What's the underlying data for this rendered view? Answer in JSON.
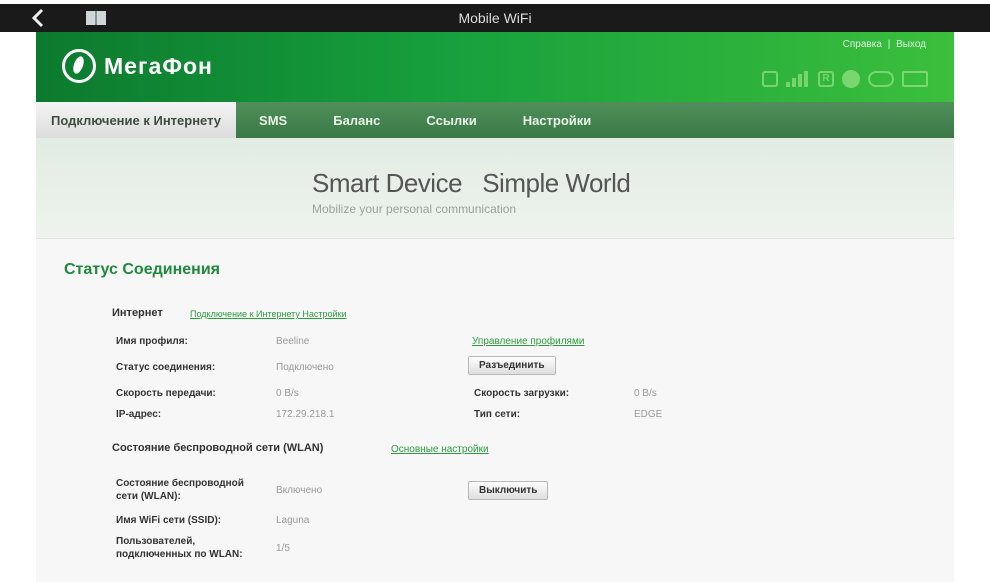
{
  "appbar": {
    "title": "Mobile WiFi",
    "back_icon": "chevron-left-icon",
    "book_icon": "book-icon"
  },
  "header": {
    "logo_text": "МегаФон",
    "help_link": "Справка",
    "separator": "|",
    "logout_link": "Выход",
    "status_icons": [
      "sim-icon",
      "signal-icon",
      "roaming-icon",
      "internet-globe-icon",
      "wifi-icon",
      "battery-icon"
    ]
  },
  "nav": {
    "tabs": [
      {
        "label": "Подключение к Интернету",
        "active": true
      },
      {
        "label": "SMS",
        "active": false
      },
      {
        "label": "Баланс",
        "active": false
      },
      {
        "label": "Ссылки",
        "active": false
      },
      {
        "label": "Настройки",
        "active": false
      }
    ]
  },
  "banner": {
    "slogan": "Smart Device   Simple World",
    "subtitle": "Mobilize your personal communication"
  },
  "content": {
    "title": "Статус Соединения",
    "internet": {
      "section_label": "Интернет",
      "settings_link": "Подключение к Интернету Настройки",
      "profile_label": "Имя профиля:",
      "profile_value": "Beeline",
      "manage_profiles_link": "Управление профилями",
      "status_label": "Статус соединения:",
      "status_value": "Подключено",
      "disconnect_button": "Разъединить",
      "upload_label": "Скорость передачи:",
      "upload_value": "0 B/s",
      "download_label": "Скорость загрузки:",
      "download_value": "0 B/s",
      "ip_label": "IP-адрес:",
      "ip_value": "172.29.218.1",
      "net_type_label": "Тип сети:",
      "net_type_value": "EDGE"
    },
    "wlan": {
      "section_label": "Состояние беспроводной сети (WLAN)",
      "settings_link": "Основные настройки",
      "state_label": "Состояние беспроводной сети (WLAN):",
      "state_value": "Включено",
      "off_button": "Выключить",
      "ssid_label": "Имя WiFi сети (SSID):",
      "ssid_value": "Laguna",
      "users_label": "Пользователей, подключенных по WLAN:",
      "users_value": "1/5"
    }
  },
  "colors": {
    "brand_green": "#17a03d",
    "nav_green": "#3b7a47",
    "title_green": "#1f8a3c"
  }
}
